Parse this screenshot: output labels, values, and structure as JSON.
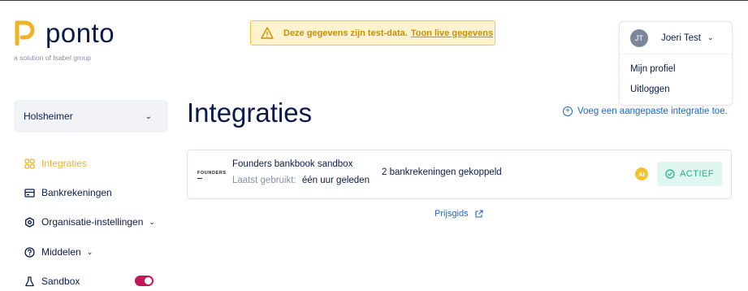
{
  "brand": {
    "name": "ponto",
    "tagline": "a solution of Isabel group",
    "accent_color": "#f0b323"
  },
  "banner": {
    "icon": "warning-icon",
    "text": "Deze gegevens zijn test-data.",
    "link": "Toon live gegevens"
  },
  "user": {
    "initials": "JT",
    "name": "Joeri Test",
    "menu": [
      "Mijn profiel",
      "Uitloggen"
    ]
  },
  "org": {
    "name": "Holsheimer"
  },
  "sidebar": {
    "items": [
      {
        "label": "Integraties",
        "icon": "integrations-grid-icon",
        "active": true
      },
      {
        "label": "Bankrekeningen",
        "icon": "bank-card-icon"
      },
      {
        "label": "Organisatie-instellingen",
        "icon": "settings-gear-icon",
        "expandable": true
      },
      {
        "label": "Middelen",
        "icon": "help-circle-icon",
        "expandable": true
      },
      {
        "label": "Sandbox",
        "icon": "flask-icon",
        "toggle": true
      }
    ]
  },
  "main": {
    "title": "Integraties",
    "add_custom_link": "Voeg een aangepaste integratie toe.",
    "integrations": [
      {
        "logo_text": "FOUNDERS",
        "name": "Founders bankbook sandbox",
        "last_used_label": "Laatst gebruikt:",
        "last_used_value": "één uur geleden",
        "accounts": "2 bankrekeningen gekoppeld",
        "badge": "AI",
        "status": "ACTIEF",
        "status_color": "#1fae8c"
      }
    ],
    "pricing_link": "Prijsgids"
  }
}
